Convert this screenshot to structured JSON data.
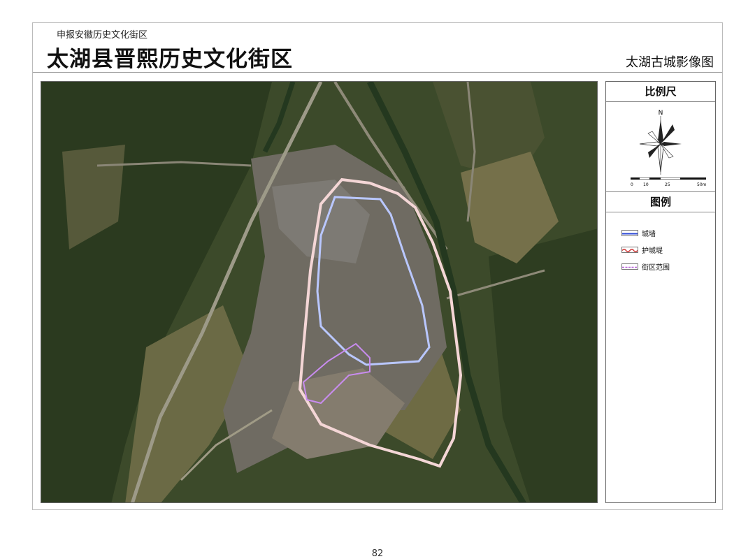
{
  "header": {
    "subtitle": "申报安徽历史文化街区",
    "title": "太湖县晋熙历史文化街区",
    "map_title": "太湖古城影像图"
  },
  "panel": {
    "scale_title": "比例尺",
    "north_label": "N",
    "scale_ticks": [
      "0",
      "10",
      "25",
      "50m"
    ],
    "legend_title": "图例",
    "legend": [
      {
        "label": "城墙",
        "color": "#2b47d6"
      },
      {
        "label": "护城堤",
        "color": "#d23a3a"
      },
      {
        "label": "街区范围",
        "color": "#b35ad8"
      }
    ]
  },
  "footer": {
    "page_number": "82"
  },
  "colors": {
    "wall_line": "#b9c7ff",
    "embankment_line": "#f4d6d6",
    "district_line": "#c98cf0"
  }
}
